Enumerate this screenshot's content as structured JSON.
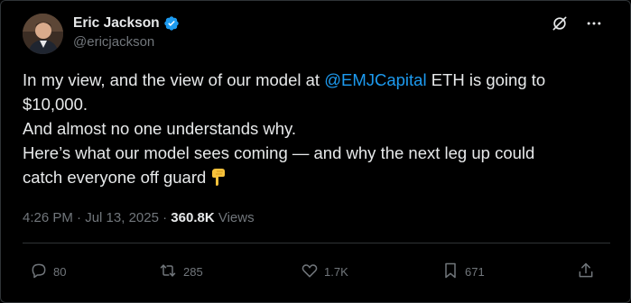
{
  "author": {
    "display_name": "Eric Jackson",
    "handle": "@ericjackson",
    "verified": true,
    "avatar_icon": "profile-photo"
  },
  "header_actions": {
    "grok_icon": "grok-icon",
    "more_icon": "more-horizontal-icon"
  },
  "tweet": {
    "line1_pre": "In my view, and the view of our model at ",
    "mention": "@EMJCapital",
    "line1_post": " ETH is going to",
    "line2": "$10,000.",
    "line3": "And almost no one understands why.",
    "line4": "Here’s what our model sees coming — and why the next leg up could",
    "line5": "catch everyone off guard",
    "emoji": "pointing-down-emoji"
  },
  "meta": {
    "time": "4:26 PM",
    "sep1": " · ",
    "date": "Jul 13, 2025",
    "sep2": " · ",
    "views_count": "360.8K",
    "views_label": " Views"
  },
  "actions": {
    "replies": "80",
    "reposts": "285",
    "likes": "1.7K",
    "bookmarks": "671"
  },
  "colors": {
    "background": "#000000",
    "text": "#e7e9ea",
    "secondary": "#71767b",
    "accent": "#1d9bf0",
    "border": "#2f3336"
  }
}
